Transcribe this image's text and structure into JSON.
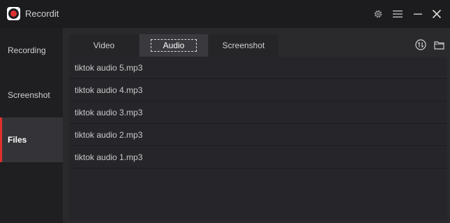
{
  "app": {
    "title": "Recordit",
    "accent_color": "#e0312f"
  },
  "titlebar": {
    "icons": [
      "gear-icon",
      "hamburger-menu-icon",
      "minimize-icon",
      "close-icon"
    ]
  },
  "sidebar": {
    "items": [
      {
        "label": "Recording",
        "active": false
      },
      {
        "label": "Screenshot",
        "active": false
      },
      {
        "label": "Files",
        "active": true
      }
    ]
  },
  "tabs": [
    {
      "label": "Video",
      "active": false
    },
    {
      "label": "Audio",
      "active": true
    },
    {
      "label": "Screenshot",
      "active": false
    }
  ],
  "toolbar": {
    "icons": [
      "convert-icon",
      "folder-icon"
    ]
  },
  "files": [
    {
      "name": "tiktok audio 5.mp3"
    },
    {
      "name": "tiktok audio 4.mp3"
    },
    {
      "name": "tiktok audio 3.mp3"
    },
    {
      "name": "tiktok audio 2.mp3"
    },
    {
      "name": "tiktok audio 1.mp3"
    }
  ]
}
